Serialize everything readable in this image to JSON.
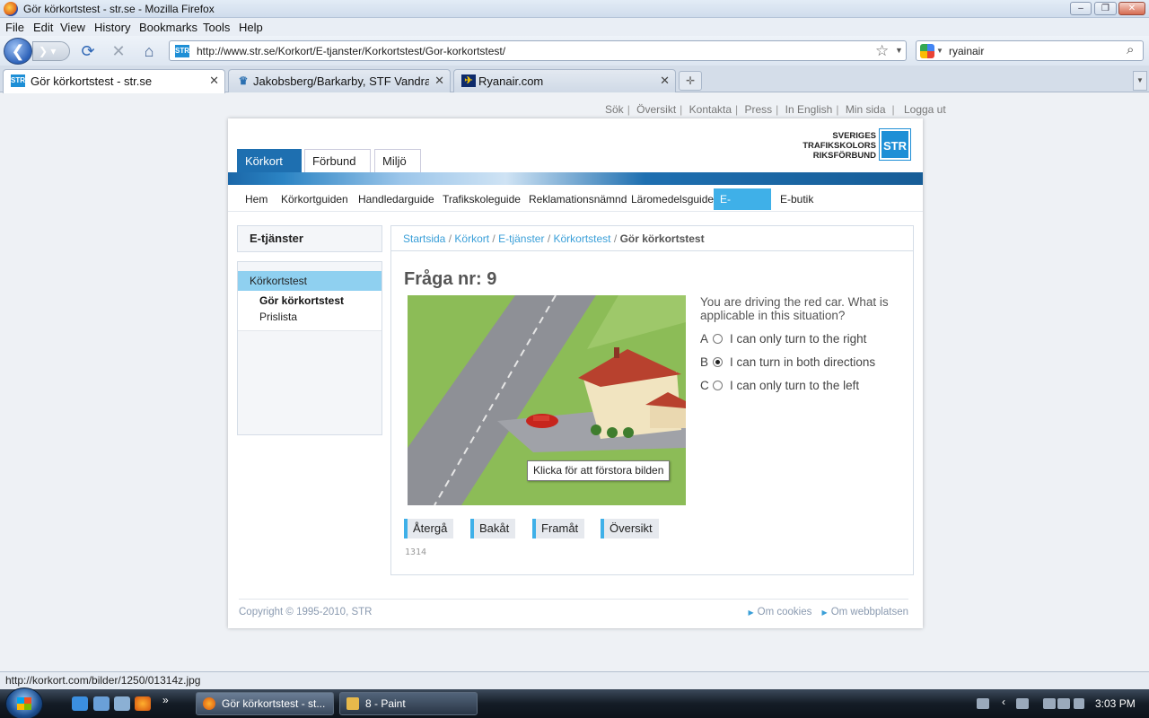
{
  "window": {
    "title": "Gör körkortstest - str.se - Mozilla Firefox",
    "controls": {
      "minimize": "–",
      "maximize": "❐",
      "close": "✕"
    }
  },
  "menu": [
    "File",
    "Edit",
    "View",
    "History",
    "Bookmarks",
    "Tools",
    "Help"
  ],
  "nav": {
    "url": "http://www.str.se/Korkort/E-tjanster/Korkortstest/Gor-korkortstest/",
    "favicon_text": "STR",
    "search_value": "ryainair"
  },
  "tabs": [
    {
      "label": "Gör körkortstest - str.se",
      "icon": "str-favicon",
      "active": true
    },
    {
      "label": "Jakobsberg/Barkarby, STF Vandrarh...",
      "icon": "stf-favicon",
      "active": false
    },
    {
      "label": "Ryanair.com",
      "icon": "ryanair-favicon",
      "active": false
    }
  ],
  "page": {
    "top_links": [
      "Sök",
      "Översikt",
      "Kontakta",
      "Press",
      "In English",
      "Min sida",
      "Logga ut"
    ],
    "main_tabs": [
      "Körkort",
      "Förbund",
      "Miljö"
    ],
    "logo": {
      "line1": "SVERIGES",
      "line2": "TRAFIKSKOLORS",
      "line3": "RIKSFÖRBUND",
      "box": "STR"
    },
    "subnav": [
      "Hem",
      "Körkortguiden",
      "Handledarguide",
      "Trafikskoleguide",
      "Reklamationsnämnd",
      "Läromedelsguide",
      "E-tjänster",
      "E-butik"
    ],
    "subnav_active": "E-tjänster",
    "sidebar": {
      "heading": "E-tjänster",
      "section": "Körkortstest",
      "items": [
        "Gör körkortstest",
        "Prislista"
      ]
    },
    "breadcrumb": [
      "Startsida",
      "Körkort",
      "E-tjänster",
      "Körkortstest"
    ],
    "breadcrumb_current": "Gör körkortstest",
    "question": {
      "title": "Fråga nr: 9",
      "text": "You are driving the red car. What is applicable in this situation?",
      "options": [
        {
          "letter": "A",
          "text": "I can only turn to the right",
          "selected": false
        },
        {
          "letter": "B",
          "text": "I can turn in both directions",
          "selected": true
        },
        {
          "letter": "C",
          "text": "I can only turn to the left",
          "selected": false
        }
      ],
      "image_tooltip": "Klicka för att förstora bilden",
      "buttons": [
        "Återgå",
        "Bakåt",
        "Framåt",
        "Översikt"
      ],
      "id": "1314"
    },
    "footer": {
      "copyright": "Copyright © 1995-2010, STR",
      "links": [
        "Om cookies",
        "Om webbplatsen"
      ]
    }
  },
  "status": "http://korkort.com/bilder/1250/01314z.jpg",
  "taskbar": {
    "tasks": [
      "Gör körkortstest - st...",
      "8 - Paint"
    ],
    "clock": "3:03 PM"
  },
  "colors": {
    "accent": "#3fb0e8",
    "brand": "#1e6fb0",
    "link": "#3a9fd8"
  }
}
